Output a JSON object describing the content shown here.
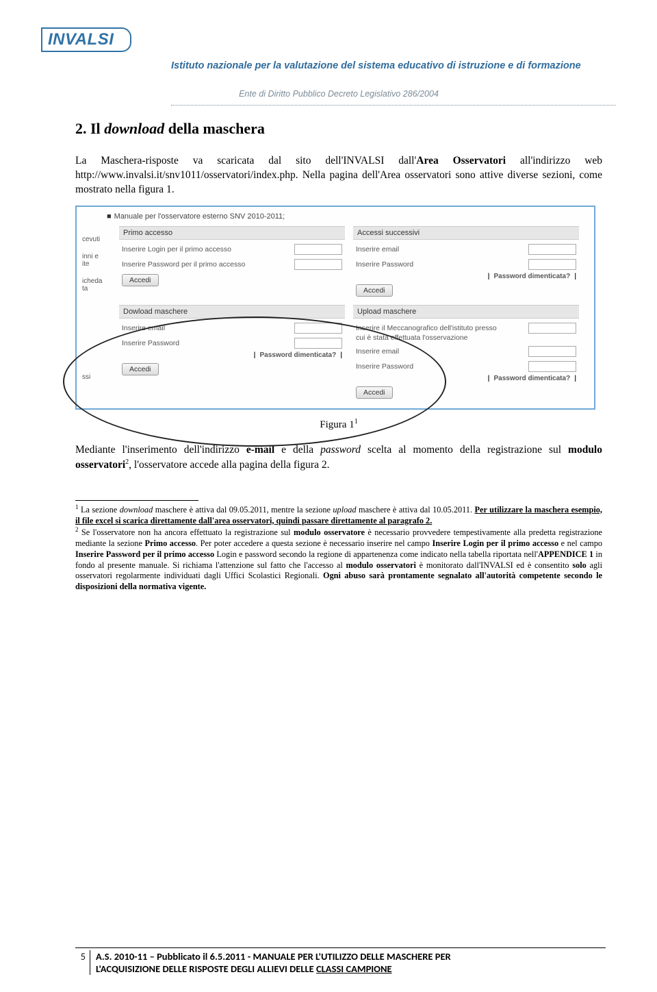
{
  "header": {
    "logo": "INVALSI",
    "institute_line": "Istituto nazionale per la valutazione del sistema educativo di istruzione e di formazione",
    "institute_sub": "Ente di Diritto Pubblico Decreto Legislativo 286/2004"
  },
  "section": {
    "number": "2.",
    "title_plain": " Il ",
    "title_italic": "download",
    "title_rest": " della maschera"
  },
  "paragraph1_a": "La Maschera-risposte va scaricata dal sito dell'INVALSI dall'",
  "paragraph1_b": "Area Osservatori",
  "paragraph1_c": " all'indirizzo web http://www.invalsi.it/snv1011/osservatori/index.php. Nella pagina dell'Area osservatori sono attive diverse sezioni, come mostrato nella figura 1.",
  "figure": {
    "toplink": "Manuale per l'osservatore esterno SNV 2010-2011;",
    "sidetabs": [
      "cevuti",
      "inni e\nite",
      "icheda\nta",
      "ssi"
    ],
    "panel1": {
      "head": "Primo accesso",
      "row1": "Inserire Login per il primo accesso",
      "row2": "Inserire Password per il primo accesso",
      "btn": "Accedi"
    },
    "panel2": {
      "head": "Accessi successivi",
      "row1": "Inserire email",
      "row2": "Inserire Password",
      "forgot": "Password dimenticata?",
      "btn": "Accedi"
    },
    "panel3": {
      "head": "Dowload maschere",
      "row1": "Inserire email",
      "row2": "Inserire Password",
      "forgot": "Password dimenticata?",
      "btn": "Accedi"
    },
    "panel4": {
      "head": "Upload maschere",
      "row0a": "Inserire il Meccanografico dell'istituto presso",
      "row0b": "cui è stata effettuata l'osservazione",
      "row1": "Inserire email",
      "row2": "Inserire Password",
      "forgot": "Password dimenticata?",
      "btn": "Accedi"
    }
  },
  "caption": "Figura 1",
  "caption_sup": "1",
  "paragraph2_a": "Mediante l'inserimento dell'indirizzo ",
  "paragraph2_b": "e-mail",
  "paragraph2_c": " e della ",
  "paragraph2_d": "password",
  "paragraph2_e": " scelta al momento della registrazione sul ",
  "paragraph2_f": "modulo osservatori",
  "paragraph2_g": "2",
  "paragraph2_h": ", l'osservatore accede alla pagina della figura 2.",
  "footnote1_a": " La sezione ",
  "footnote1_b": "download",
  "footnote1_c": " maschere è attiva dal 09.05.2011, mentre la sezione ",
  "footnote1_d": "upload",
  "footnote1_e": " maschere è attiva dal 10.05.2011. ",
  "footnote1_u": "Per utilizzare la maschera esempio, il file excel si scarica direttamente dall'area osservatori, quindi passare direttamente al paragrafo 2.",
  "footnote2_a": " Se l'osservatore non ha ancora effettuato la registrazione sul ",
  "footnote2_b": "modulo osservatore",
  "footnote2_c": " è necessario provvedere tempestivamente alla predetta registrazione mediante la sezione ",
  "footnote2_d": "Primo accesso",
  "footnote2_e": ". Per poter accedere a questa sezione è necessario inserire nel campo ",
  "footnote2_f": "Inserire Login per il primo accesso",
  "footnote2_g": " e nel campo ",
  "footnote2_h": "Inserire Password per il primo accesso",
  "footnote2_i": " Login e password secondo la regione di appartenenza come indicato nella tabella riportata nell'",
  "footnote2_j": "APPENDICE 1",
  "footnote2_k": " in fondo al presente manuale. Si richiama l'attenzione sul fatto che l'accesso al ",
  "footnote2_l": "modulo osservatori",
  "footnote2_m": " è monitorato dall'INVALSI ed è consentito ",
  "footnote2_n": "solo",
  "footnote2_o": " agli osservatori regolarmente individuati dagli Uffici Scolastici Regionali. ",
  "footnote2_p": "Ogni abuso sarà prontamente segnalato all'autorità competente secondo le disposizioni della normativa vigente.",
  "footer": {
    "page": "5",
    "line1": "A.S. 2010-11 – Pubblicato il 6.5.2011 - MANUALE PER L'UTILIZZO DELLE MASCHERE PER",
    "line2_a": "L'ACQUISIZIONE DELLE RISPOSTE DEGLI ALLIEVI DELLE ",
    "line2_b": "CLASSI CAMPIONE"
  }
}
